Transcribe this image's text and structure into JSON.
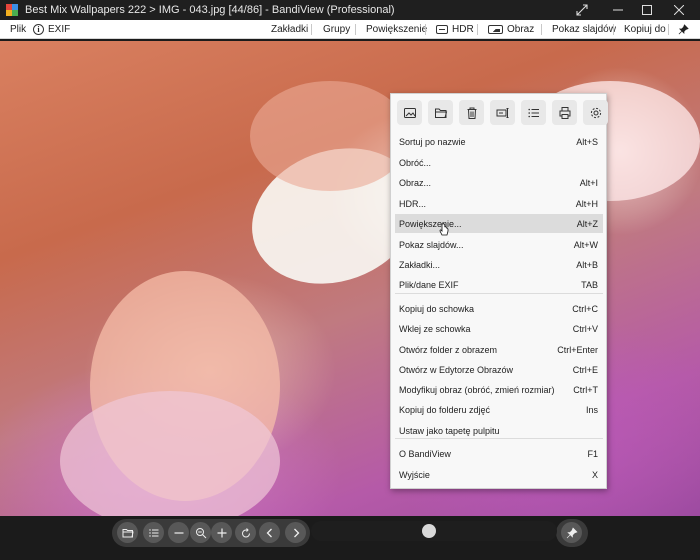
{
  "window": {
    "title": "Best Mix Wallpapers 222 > IMG - 043.jpg [44/86] - BandiView (Professional)",
    "app_icon_colors": [
      "#e6463c",
      "#3a8ee6",
      "#f2b020",
      "#4caf50"
    ]
  },
  "menubar": {
    "left": [
      {
        "label": "Plik",
        "icon": ""
      },
      {
        "label": "EXIF",
        "icon": "info-icon"
      }
    ],
    "right": [
      {
        "label": "Zakładki",
        "icon": ""
      },
      {
        "label": "Grupy",
        "icon": ""
      },
      {
        "label": "Powiększenie",
        "icon": ""
      },
      {
        "label": "HDR",
        "icon": "hdr-icon"
      },
      {
        "label": "Obraz",
        "icon": "image-icon"
      },
      {
        "label": "Pokaz slajdów",
        "icon": ""
      },
      {
        "label": "Kopiuj do",
        "icon": ""
      }
    ]
  },
  "context_menu": {
    "toolbar": [
      "image-icon",
      "folder-open-icon",
      "trash-icon",
      "rename-icon",
      "list-icon",
      "print-icon",
      "gear-icon"
    ],
    "groups": [
      [
        {
          "label": "Sortuj po nazwie",
          "shortcut": "Alt+S"
        },
        {
          "label": "Obróć...",
          "shortcut": ""
        },
        {
          "label": "Obraz...",
          "shortcut": "Alt+I"
        },
        {
          "label": "HDR...",
          "shortcut": "Alt+H"
        },
        {
          "label": "Powiększenie...",
          "shortcut": "Alt+Z",
          "highlighted": true
        },
        {
          "label": "Pokaz slajdów...",
          "shortcut": "Alt+W"
        },
        {
          "label": "Zakładki...",
          "shortcut": "Alt+B"
        },
        {
          "label": "Plik/dane EXIF",
          "shortcut": "TAB"
        }
      ],
      [
        {
          "label": "Kopiuj do schowka",
          "shortcut": "Ctrl+C"
        },
        {
          "label": "Wklej ze schowka",
          "shortcut": "Ctrl+V"
        },
        {
          "label": "Otwórz folder z obrazem",
          "shortcut": "Ctrl+Enter"
        },
        {
          "label": "Otwórz w Edytorze Obrazów",
          "shortcut": "Ctrl+E"
        },
        {
          "label": "Modyfikuj obraz (obróć, zmień rozmiar)",
          "shortcut": "Ctrl+T"
        },
        {
          "label": "Kopiuj do folderu zdjęć",
          "shortcut": "Ins"
        },
        {
          "label": "Ustaw jako tapetę pulpitu",
          "shortcut": ""
        }
      ],
      [
        {
          "label": "O BandiView",
          "shortcut": "F1"
        },
        {
          "label": "Wyjście",
          "shortcut": "X"
        }
      ]
    ]
  },
  "bottom_bar": {
    "buttons": [
      "folder-open-icon",
      "list-icon",
      "zoom-out-icon",
      "zoom-fit-icon",
      "zoom-in-icon",
      "rotate-icon",
      "prev-icon",
      "next-icon"
    ],
    "slider_position": 0.48,
    "pin": "pin-icon"
  }
}
